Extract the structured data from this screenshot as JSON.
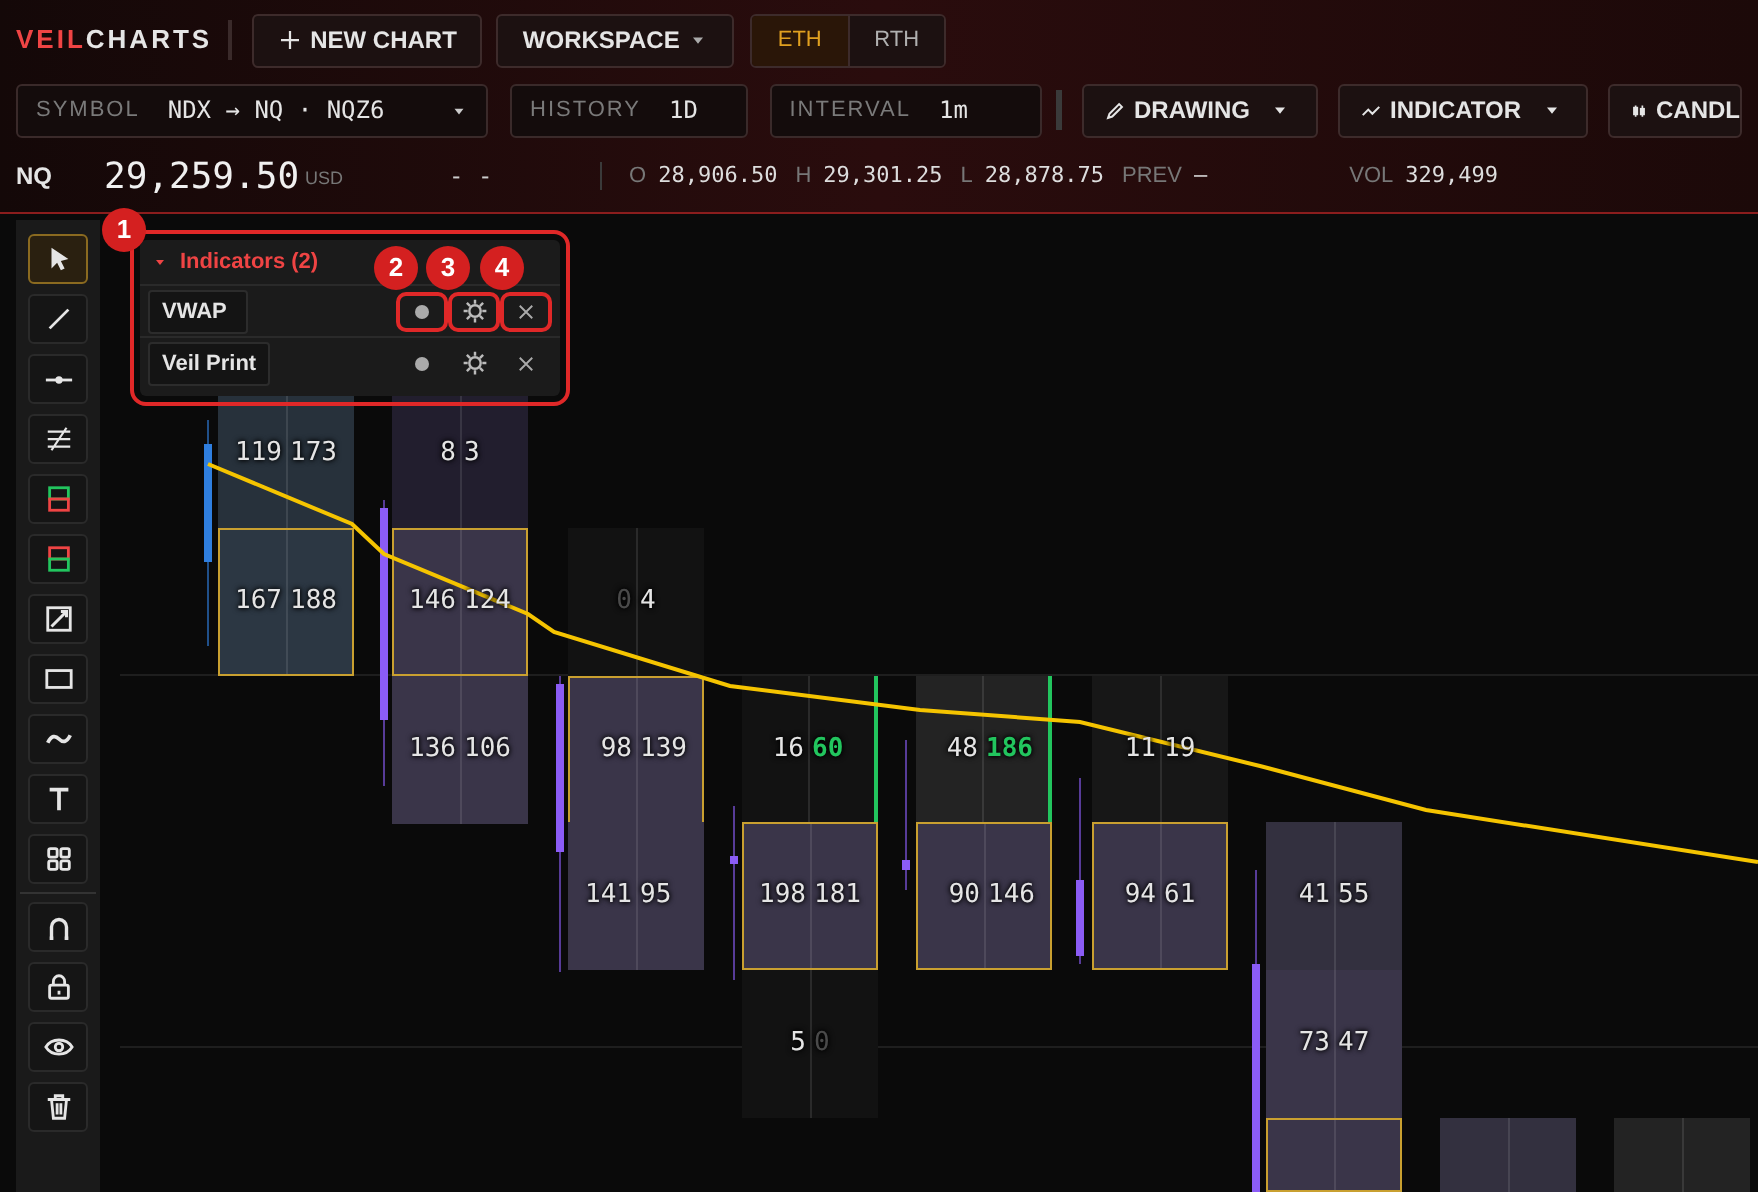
{
  "header": {
    "logo": {
      "accent": "VEIL",
      "rest": "CHARTS"
    },
    "buttons": [
      {
        "label": "NEW CHART",
        "kind": "new"
      },
      {
        "label": "WORKSPACE",
        "kind": "dropdown"
      }
    ],
    "sessions": [
      {
        "label": "ETH",
        "selected": true
      },
      {
        "label": "RTH",
        "selected": false
      }
    ]
  },
  "controls": {
    "fields": [
      {
        "label": "SYMBOL",
        "value": "NDX → NQ · NQZ6",
        "kind": "dropdown"
      },
      {
        "label": "HISTORY",
        "value": "1D",
        "kind": "plain"
      },
      {
        "label": "INTERVAL",
        "value": "1m",
        "kind": "plain"
      }
    ],
    "menus": [
      {
        "label": "DRAWING",
        "kind": "pencil"
      },
      {
        "label": "INDICATOR",
        "kind": "trend"
      },
      {
        "label": "CANDL",
        "kind": "candles"
      }
    ]
  },
  "quote": {
    "symbol": "NQ",
    "price": "29,259.50",
    "currency": "USD",
    "change": "- -",
    "stats": [
      {
        "label": "O",
        "value": "28,906.50"
      },
      {
        "label": "H",
        "value": "29,301.25"
      },
      {
        "label": "L",
        "value": "28,878.75"
      },
      {
        "label": "PREV",
        "value": "–"
      },
      {
        "label": "VOL",
        "value": "329,499"
      }
    ]
  },
  "tools": [
    {
      "kind": "cursor",
      "selected": true
    },
    {
      "kind": "line",
      "selected": false
    },
    {
      "kind": "hline",
      "selected": false
    },
    {
      "kind": "channel",
      "selected": false
    },
    {
      "kind": "long",
      "selected": false
    },
    {
      "kind": "short",
      "selected": false
    },
    {
      "kind": "measure",
      "selected": false
    },
    {
      "kind": "rect",
      "selected": false
    },
    {
      "kind": "wave",
      "selected": false
    },
    {
      "kind": "text",
      "selected": false
    },
    {
      "kind": "grid",
      "selected": false
    },
    {
      "kind": "magnet",
      "selected": false
    },
    {
      "kind": "lock",
      "selected": false
    },
    {
      "kind": "eye",
      "selected": false
    },
    {
      "kind": "trash",
      "selected": false
    }
  ],
  "indicators_panel": {
    "title": "Indicators (2)",
    "expanded": true,
    "items": [
      {
        "name": "VWAP",
        "highlighted": true
      },
      {
        "name": "Veil Print",
        "highlighted": false
      }
    ]
  },
  "callouts": [
    "1",
    "2",
    "3",
    "4"
  ],
  "footprint": {
    "rows": [
      [
        {
          "color": "#27313b",
          "poc": false,
          "edge": false,
          "values": [
            {
              "text": "119",
              "kind": "normal"
            },
            {
              "text": "173",
              "kind": "normal"
            }
          ]
        },
        {
          "color": "#221e2e",
          "poc": false,
          "edge": false,
          "values": [
            {
              "text": "8",
              "kind": "normal"
            },
            {
              "text": "3",
              "kind": "normal"
            }
          ]
        },
        null,
        null,
        null,
        null,
        null,
        null,
        null
      ],
      [
        {
          "color": "#2c3743",
          "poc": true,
          "edge": false,
          "values": [
            {
              "text": "167",
              "kind": "normal"
            },
            {
              "text": "188",
              "kind": "normal"
            }
          ]
        },
        {
          "color": "#3a3549",
          "poc": true,
          "edge": false,
          "values": [
            {
              "text": "146",
              "kind": "normal"
            },
            {
              "text": "124",
              "kind": "normal"
            }
          ]
        },
        {
          "color": "#121212",
          "poc": false,
          "edge": false,
          "values": [
            {
              "text": "0",
              "kind": "dim"
            },
            {
              "text": "4",
              "kind": "normal"
            }
          ]
        },
        null,
        null,
        null,
        null,
        null,
        null
      ],
      [
        null,
        {
          "color": "#3a3549",
          "poc": false,
          "edge": false,
          "values": [
            {
              "text": "136",
              "kind": "normal"
            },
            {
              "text": "106",
              "kind": "normal"
            }
          ]
        },
        {
          "color": "#3a3549",
          "poc": true,
          "edge": false,
          "values": [
            {
              "text": "98",
              "kind": "normal"
            },
            {
              "text": "139",
              "kind": "normal"
            }
          ]
        },
        {
          "color": "#121212",
          "poc": false,
          "edge": true,
          "values": [
            {
              "text": "16",
              "kind": "normal"
            },
            {
              "text": "60",
              "kind": "green"
            }
          ]
        },
        {
          "color": "#232323",
          "poc": false,
          "edge": true,
          "values": [
            {
              "text": "48",
              "kind": "normal"
            },
            {
              "text": "186",
              "kind": "green"
            }
          ]
        },
        {
          "color": "#171717",
          "poc": false,
          "edge": false,
          "values": [
            {
              "text": "11",
              "kind": "normal"
            },
            {
              "text": "19",
              "kind": "normal"
            }
          ]
        },
        null,
        null,
        null
      ],
      [
        null,
        null,
        {
          "color": "#3a3549",
          "poc": false,
          "edge": false,
          "values": [
            {
              "text": "141",
              "kind": "normal"
            },
            {
              "text": "95",
              "kind": "normal"
            }
          ]
        },
        {
          "color": "#3a3549",
          "poc": true,
          "edge": false,
          "values": [
            {
              "text": "198",
              "kind": "normal"
            },
            {
              "text": "181",
              "kind": "normal"
            }
          ]
        },
        {
          "color": "#3a3549",
          "poc": true,
          "edge": false,
          "values": [
            {
              "text": "90",
              "kind": "normal"
            },
            {
              "text": "146",
              "kind": "normal"
            }
          ]
        },
        {
          "color": "#3a3549",
          "poc": true,
          "edge": false,
          "values": [
            {
              "text": "94",
              "kind": "normal"
            },
            {
              "text": "61",
              "kind": "normal"
            }
          ]
        },
        {
          "color": "#33303f",
          "poc": false,
          "edge": false,
          "values": [
            {
              "text": "41",
              "kind": "normal"
            },
            {
              "text": "55",
              "kind": "normal"
            }
          ]
        },
        null,
        null
      ],
      [
        null,
        null,
        null,
        {
          "color": "#121212",
          "poc": false,
          "edge": false,
          "values": [
            {
              "text": "5",
              "kind": "normal"
            },
            {
              "text": "0",
              "kind": "dim"
            }
          ]
        },
        null,
        null,
        {
          "color": "#3a3549",
          "poc": false,
          "edge": false,
          "values": [
            {
              "text": "73",
              "kind": "normal"
            },
            {
              "text": "47",
              "kind": "normal"
            }
          ]
        },
        null,
        null
      ],
      [
        null,
        null,
        null,
        null,
        null,
        null,
        {
          "color": "#3a3549",
          "poc": true,
          "edge": false
        },
        {
          "color": "#33303f",
          "poc": false,
          "edge": false
        },
        {
          "color": "#232323",
          "poc": false,
          "edge": false
        }
      ]
    ]
  }
}
